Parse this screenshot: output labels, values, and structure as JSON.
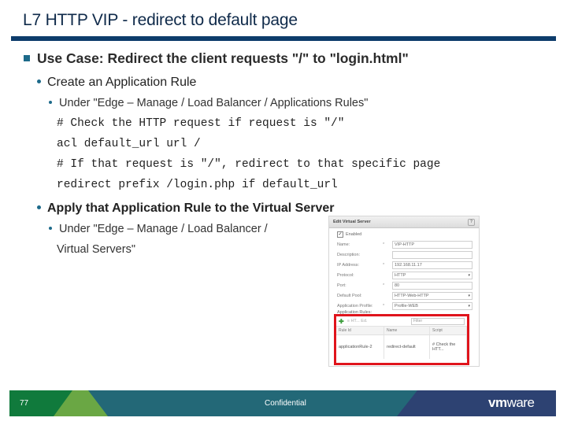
{
  "slide": {
    "title": "L7 HTTP VIP - redirect to default page",
    "bullets": {
      "level1": "Use Case: Redirect the client requests \"/\" to \"login.html\"",
      "create_rule": "Create an Application Rule",
      "create_rule_path": "Under \"Edge – Manage /  Load Balancer / Applications Rules\"",
      "code_lines": [
        "# Check the HTTP request if request is \"/\"",
        "acl default_url url /",
        "# If that request is \"/\", redirect to that specific page",
        "redirect prefix /login.php if default_url"
      ],
      "apply_rule": "Apply that Application Rule to the Virtual Server",
      "apply_rule_path_1": "Under \"Edge – Manage /  Load Balancer /",
      "apply_rule_path_2": "Virtual Servers\""
    }
  },
  "dialog": {
    "title": "Edit Virtual Server",
    "help": "?",
    "enabled_label": "Enabled",
    "enabled_checked": true,
    "fields": [
      {
        "label": "Name:",
        "required": "*",
        "value": "VIP-HTTP",
        "type": "text"
      },
      {
        "label": "Description:",
        "required": "",
        "value": "",
        "type": "text"
      },
      {
        "label": "IP Address:",
        "required": "*",
        "value": "192.168.11.17",
        "type": "text"
      },
      {
        "label": "Protocol:",
        "required": "",
        "value": "HTTP",
        "type": "select"
      },
      {
        "label": "Port:",
        "required": "*",
        "value": "80",
        "type": "text"
      },
      {
        "label": "Default Pool:",
        "required": "",
        "value": "HTTP-Web-HTTP",
        "type": "select"
      },
      {
        "label": "Application Profile:",
        "required": "*",
        "value": "Profile-WEB",
        "type": "select"
      }
    ],
    "app_rules_label": "Application Rules:",
    "grid": {
      "add_icon": "plus-icon",
      "toolbar_text": "≡  HT... Ed.",
      "filter_placeholder": "Filter",
      "columns": [
        "Rule Id",
        "Name",
        "Script"
      ],
      "rows": [
        [
          "applicationRule-2",
          "redirect-default",
          "# Check the HTT..."
        ]
      ]
    }
  },
  "footer": {
    "page_number": "77",
    "confidential": "Confidential",
    "logo_bold": "vm",
    "logo_light": "ware",
    "colors": {
      "green_dark": "#107a3c",
      "green_light": "#6aa744",
      "teal": "#236877",
      "navy": "#2d4272"
    }
  }
}
